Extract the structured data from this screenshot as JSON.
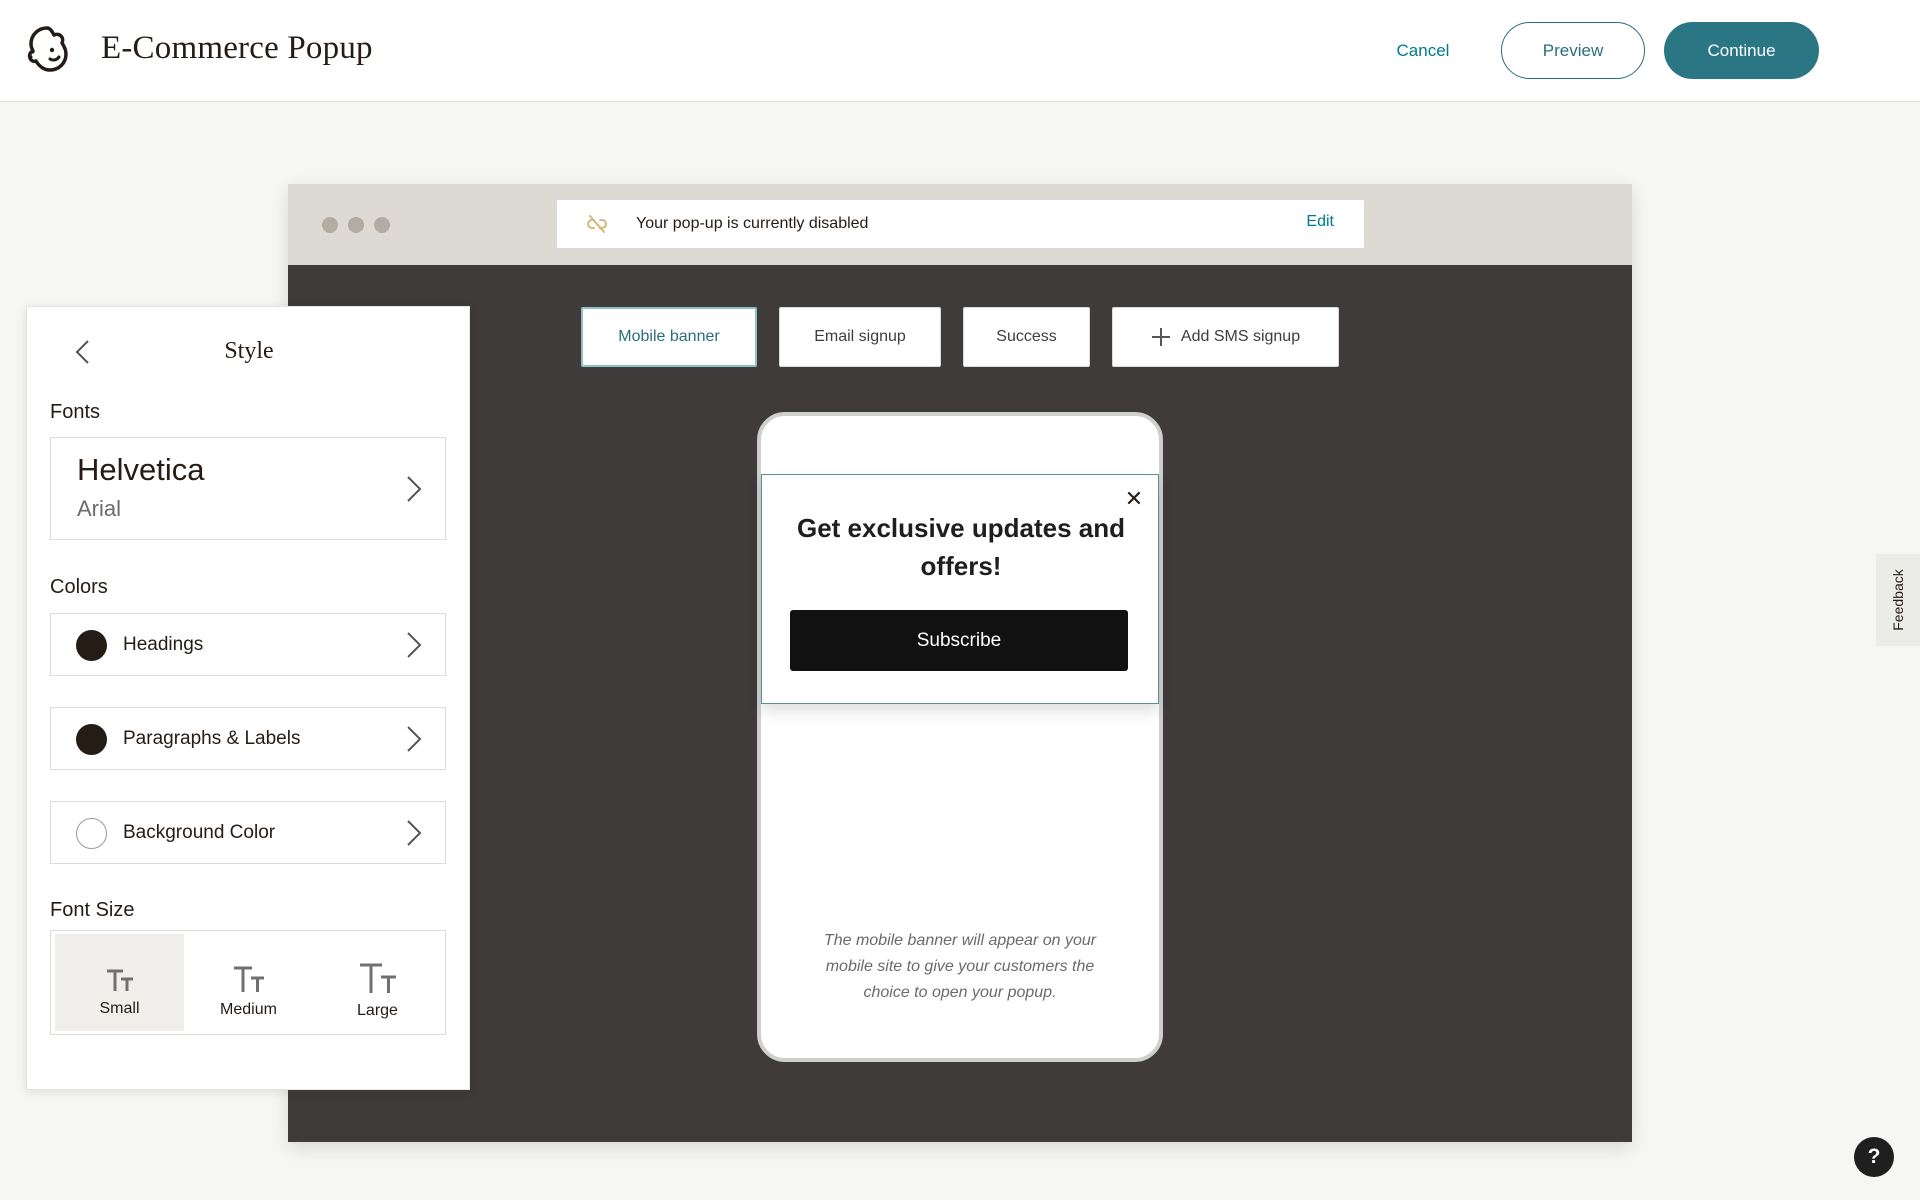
{
  "header": {
    "title": "E-Commerce Popup",
    "cancel_label": "Cancel",
    "preview_label": "Preview",
    "continue_label": "Continue",
    "logo_icon": "mailchimp-logo"
  },
  "browser": {
    "status_text": "Your pop-up is currently disabled",
    "status_icon": "unlink-icon",
    "edit_label": "Edit",
    "tabs": [
      {
        "label": "Mobile banner",
        "active": true
      },
      {
        "label": "Email signup",
        "active": false
      },
      {
        "label": "Success",
        "active": false
      },
      {
        "label": "Add SMS signup",
        "active": false,
        "icon": "plus-icon"
      }
    ]
  },
  "preview": {
    "heading": "Get exclusive updates and offers!",
    "subscribe_label": "Subscribe",
    "note": "The mobile banner will appear on your mobile site to give your customers the choice to open your popup."
  },
  "panel": {
    "title": "Style",
    "fonts_label": "Fonts",
    "font_primary": "Helvetica",
    "font_fallback": "Arial",
    "colors_label": "Colors",
    "colors": [
      {
        "label": "Headings",
        "swatch": "#241c15"
      },
      {
        "label": "Paragraphs & Labels",
        "swatch": "#241c15"
      },
      {
        "label": "Background Color",
        "swatch": "#ffffff"
      }
    ],
    "font_size_label": "Font Size",
    "sizes": [
      {
        "label": "Small",
        "selected": true
      },
      {
        "label": "Medium",
        "selected": false
      },
      {
        "label": "Large",
        "selected": false
      }
    ]
  },
  "feedback_label": "Feedback",
  "help_label": "?",
  "theme": {
    "accent": "#2a7684",
    "link": "#007c89",
    "browser_body": "#3f3b3a",
    "browser_chrome": "#dcdad3"
  }
}
